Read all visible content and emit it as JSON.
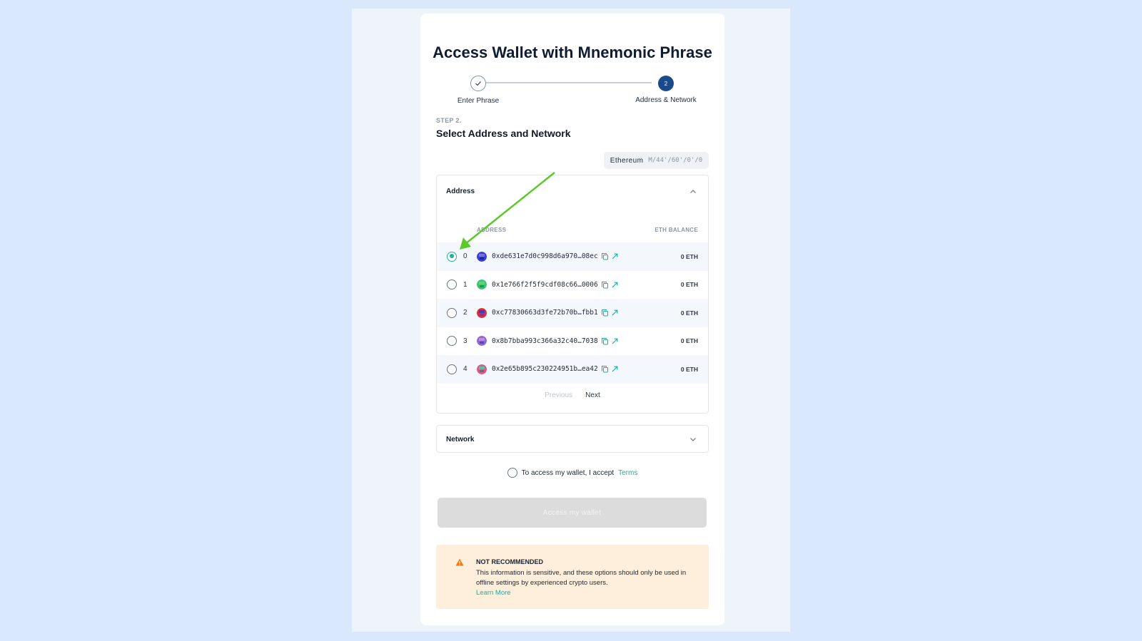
{
  "title": "Access Wallet with Mnemonic Phrase",
  "stepper": {
    "step1_label": "Enter Phrase",
    "step2_label": "Address & Network",
    "step2_number": "2"
  },
  "step": {
    "kicker": "STEP 2.",
    "heading": "Select Address and Network"
  },
  "derivation": {
    "network": "Ethereum",
    "path": "M/44'/60'/0'/0"
  },
  "address_panel": {
    "title": "Address",
    "col_address": "ADDRESS",
    "col_balance": "ETH BALANCE",
    "rows": [
      {
        "index": "0",
        "address": "0xde631e7d0c998d6a970…08ec",
        "balance": "0 ETH",
        "selected": true,
        "colors": [
          "#3a3fd6",
          "#7b6fd8",
          "#1c2a8c"
        ]
      },
      {
        "index": "1",
        "address": "0x1e766f2f5f9cdf08c66…0006",
        "balance": "0 ETH",
        "selected": false,
        "colors": [
          "#3bc47a",
          "#64d36e",
          "#1c9a5a"
        ]
      },
      {
        "index": "2",
        "address": "0xc77830663d3fe72b70b…fbb1",
        "balance": "0 ETH",
        "selected": false,
        "colors": [
          "#d8303a",
          "#3b3fbf",
          "#a42a6a"
        ]
      },
      {
        "index": "3",
        "address": "0x8b7bba993c366a32c40…7038",
        "balance": "0 ETH",
        "selected": false,
        "colors": [
          "#8b6ad8",
          "#c48ad6",
          "#5a4aa8"
        ]
      },
      {
        "index": "4",
        "address": "0x2e65b895c230224951b…ea42",
        "balance": "0 ETH",
        "selected": false,
        "colors": [
          "#e3548a",
          "#4fc7a0",
          "#2a8f6f"
        ]
      }
    ],
    "prev_label": "Previous",
    "next_label": "Next"
  },
  "network_panel": {
    "title": "Network"
  },
  "terms": {
    "text": "To access my wallet, I accept",
    "link": "Terms"
  },
  "access_button": "Access my wallet",
  "warning": {
    "title": "NOT RECOMMENDED",
    "body": "This information is sensitive, and these options should only be used in offline settings by experienced crypto users.",
    "link": "Learn More"
  },
  "colors": {
    "accent": "#1fae9e",
    "step_active": "#1b4a8c",
    "warning_bg": "#fdefdc",
    "warning_icon": "#f07a1a",
    "annotation_arrow": "#5cc92a"
  }
}
